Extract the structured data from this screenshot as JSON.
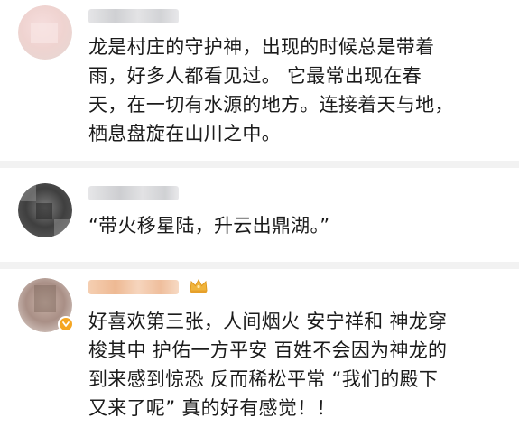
{
  "comments": [
    {
      "username": "",
      "text": "龙是村庄的守护神，出现的时候总是带着\n雨，好多人都看见过。 它最常出现在春\n天，在一切有水源的地方。连接着天与地，\n栖息盘旋在山川之中。",
      "avatar_icon": "blurred-avatar"
    },
    {
      "username": "",
      "text": "“带火移星陆，升云出鼎湖。”",
      "avatar_icon": "blurred-avatar"
    },
    {
      "username": "",
      "text": "好喜欢第三张，人间烟火 安宁祥和 神龙穿\n梭其中 护佑一方平安   百姓不会因为神龙的\n到来感到惊恐 反而稀松平常 “我们的殿下\n又来了呢” 真的好有感觉！！",
      "avatar_icon": "blurred-avatar",
      "badges": [
        "verified-icon",
        "crown-icon"
      ]
    }
  ],
  "colors": {
    "text": "#1b1b1b",
    "divider": "#f2f2f2",
    "verified": "#f5a623",
    "crown": "#f0b43c",
    "username_blur_1": "#d7d7d9",
    "username_blur_3": "#f3c7a6"
  }
}
